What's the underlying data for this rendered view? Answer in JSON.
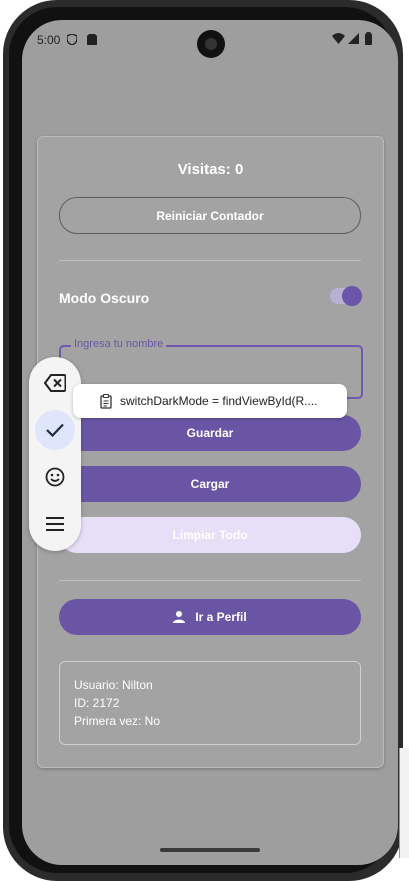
{
  "status_bar": {
    "time": "5:00"
  },
  "main": {
    "visits_label": "Visitas: 0",
    "reset_button_label": "Reiniciar Contador",
    "dark_mode_label": "Modo Oscuro",
    "dark_mode_on": true,
    "name_input": {
      "label": "Ingresa tu nombre",
      "value": ""
    },
    "save_button_label": "Guardar",
    "load_button_label": "Cargar",
    "clear_all_button_label": "Limpiar Todo",
    "profile_button_label": "Ir a Perfil",
    "info": {
      "user_line": "Usuario: Nilton",
      "id_line": "ID: 2172",
      "first_time_line": "Primera vez: No"
    }
  },
  "clipboard_suggestion": {
    "text": "switchDarkMode = findViewById(R...."
  },
  "floating_toolbar": {
    "items": [
      "backspace-icon",
      "check-icon",
      "emoji-icon",
      "menu-icon"
    ]
  },
  "colors": {
    "primary": "#6a55a5",
    "tonal": "#e7dff7",
    "scrim": "#9e9e9e",
    "toolbar_active": "#dfe5fb"
  }
}
